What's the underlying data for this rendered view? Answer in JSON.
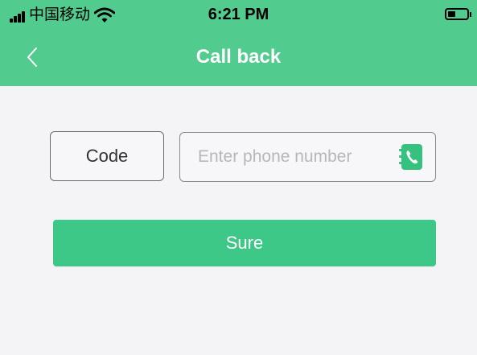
{
  "status_bar": {
    "carrier": "中国移动",
    "time": "6:21 PM",
    "icons": [
      "signal-icon",
      "wifi-icon",
      "battery-icon"
    ]
  },
  "nav": {
    "title": "Call back",
    "back_icon": "chevron-left-icon"
  },
  "form": {
    "code_label": "Code",
    "phone_placeholder": "Enter phone number",
    "phone_value": "",
    "contacts_icon": "phone-book-icon",
    "submit_label": "Sure"
  },
  "colors": {
    "header": "#52cc8e",
    "button": "#3ec887",
    "background": "#f4f4f6"
  }
}
